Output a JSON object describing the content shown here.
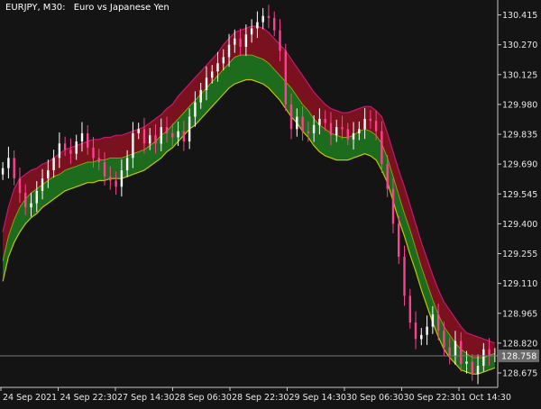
{
  "header": {
    "symbol": "EURJPY, M30:",
    "description": "Euro vs Japanese Yen"
  },
  "colors": {
    "background": "#141414",
    "axis": "#c8c8c8",
    "bull_candle": "#ffffff",
    "bear_candle": "#ff3f8f",
    "upper_band": "#c21a70",
    "middle_band": "#b8d400",
    "lower_band": "#c6c400",
    "upper_fill": "#8b1020",
    "lower_fill": "#1f7a1f",
    "price_line": "#7a7a7a",
    "price_box": "#6a6a6a"
  },
  "chart_data": {
    "type": "line",
    "y_ticks": [
      "130.415",
      "130.270",
      "130.125",
      "129.980",
      "129.835",
      "129.690",
      "129.545",
      "129.400",
      "129.255",
      "129.110",
      "128.965",
      "128.820",
      "128.675"
    ],
    "x_ticks": [
      "24 Sep 2021",
      "24 Sep 22:30",
      "27 Sep 14:30",
      "28 Sep 06:30",
      "28 Sep 22:30",
      "29 Sep 14:30",
      "30 Sep 06:30",
      "30 Sep 22:30",
      "1 Oct 14:30"
    ],
    "ylim": [
      128.605,
      130.47
    ],
    "current_price": "128.758",
    "series": [
      {
        "kind": "price",
        "close": [
          129.67,
          129.72,
          129.62,
          129.55,
          129.48,
          129.5,
          129.56,
          129.62,
          129.66,
          129.72,
          129.79,
          129.76,
          129.74,
          129.8,
          129.84,
          129.77,
          129.72,
          129.7,
          129.63,
          129.61,
          129.58,
          129.66,
          129.72,
          129.84,
          129.86,
          129.79,
          129.83,
          129.79,
          129.87,
          129.84,
          129.82,
          129.85,
          129.8,
          129.92,
          129.99,
          130.05,
          130.11,
          130.14,
          130.18,
          130.21,
          130.27,
          130.3,
          130.26,
          130.32,
          130.35,
          130.38,
          130.41,
          130.4,
          130.34,
          130.24,
          129.98,
          129.86,
          129.92,
          129.85,
          129.84,
          129.88,
          129.91,
          129.89,
          129.83,
          129.87,
          129.86,
          129.81,
          129.84,
          129.86,
          129.91,
          129.9,
          129.85,
          129.69,
          129.57,
          129.4,
          129.24,
          129.05,
          128.92,
          128.84,
          128.86,
          128.9,
          128.96,
          128.88,
          128.8,
          128.76,
          128.83,
          128.72,
          128.73,
          128.67,
          128.71,
          128.79,
          128.76,
          128.76
        ]
      },
      {
        "kind": "upper",
        "values": [
          129.36,
          129.48,
          129.57,
          129.62,
          129.64,
          129.66,
          129.67,
          129.69,
          129.7,
          129.72,
          129.74,
          129.76,
          129.77,
          129.78,
          129.79,
          129.8,
          129.81,
          129.81,
          129.82,
          129.82,
          129.83,
          129.83,
          129.84,
          129.85,
          129.86,
          129.87,
          129.89,
          129.91,
          129.93,
          129.96,
          129.98,
          130.02,
          130.05,
          130.08,
          130.11,
          130.14,
          130.17,
          130.2,
          130.23,
          130.27,
          130.3,
          130.33,
          130.34,
          130.35,
          130.36,
          130.36,
          130.35,
          130.33,
          130.3,
          130.27,
          130.24,
          130.2,
          130.16,
          130.12,
          130.08,
          130.04,
          130.01,
          129.98,
          129.96,
          129.95,
          129.94,
          129.94,
          129.95,
          129.96,
          129.97,
          129.97,
          129.95,
          129.92,
          129.84,
          129.75,
          129.66,
          129.58,
          129.49,
          129.4,
          129.31,
          129.23,
          129.15,
          129.08,
          129.02,
          128.98,
          128.94,
          128.9,
          128.87,
          128.86,
          128.85,
          128.84,
          128.83,
          128.82
        ]
      },
      {
        "kind": "middle",
        "values": [
          129.22,
          129.34,
          129.42,
          129.48,
          129.52,
          129.55,
          129.57,
          129.59,
          129.61,
          129.63,
          129.64,
          129.66,
          129.67,
          129.68,
          129.69,
          129.7,
          129.7,
          129.71,
          129.71,
          129.72,
          129.72,
          129.72,
          129.73,
          129.74,
          129.75,
          129.76,
          129.78,
          129.8,
          129.83,
          129.85,
          129.88,
          129.91,
          129.94,
          129.97,
          130.0,
          130.03,
          130.06,
          130.09,
          130.12,
          130.15,
          130.18,
          130.21,
          130.22,
          130.22,
          130.22,
          130.21,
          130.2,
          130.18,
          130.15,
          130.12,
          130.09,
          130.06,
          130.02,
          129.98,
          129.95,
          129.91,
          129.88,
          129.86,
          129.84,
          129.83,
          129.82,
          129.82,
          129.83,
          129.85,
          129.86,
          129.85,
          129.83,
          129.79,
          129.72,
          129.63,
          129.54,
          129.45,
          129.37,
          129.28,
          129.19,
          129.11,
          129.03,
          128.96,
          128.9,
          128.86,
          128.82,
          128.79,
          128.77,
          128.75,
          128.75,
          128.75,
          128.76,
          128.77
        ]
      },
      {
        "kind": "lower",
        "values": [
          129.12,
          129.24,
          129.31,
          129.36,
          129.4,
          129.43,
          129.45,
          129.48,
          129.5,
          129.52,
          129.54,
          129.56,
          129.57,
          129.58,
          129.59,
          129.6,
          129.6,
          129.61,
          129.61,
          129.62,
          129.62,
          129.62,
          129.63,
          129.64,
          129.65,
          129.66,
          129.68,
          129.7,
          129.72,
          129.75,
          129.77,
          129.8,
          129.83,
          129.86,
          129.88,
          129.91,
          129.94,
          129.97,
          130.0,
          130.03,
          130.06,
          130.08,
          130.09,
          130.1,
          130.1,
          130.09,
          130.08,
          130.06,
          130.03,
          130.0,
          129.96,
          129.92,
          129.89,
          129.85,
          129.82,
          129.78,
          129.75,
          129.73,
          129.72,
          129.71,
          129.71,
          129.71,
          129.72,
          129.73,
          129.74,
          129.73,
          129.71,
          129.66,
          129.6,
          129.51,
          129.42,
          129.34,
          129.25,
          129.17,
          129.08,
          129.0,
          128.92,
          128.85,
          128.79,
          128.75,
          128.72,
          128.69,
          128.68,
          128.67,
          128.67,
          128.68,
          128.69,
          128.7
        ]
      }
    ]
  }
}
